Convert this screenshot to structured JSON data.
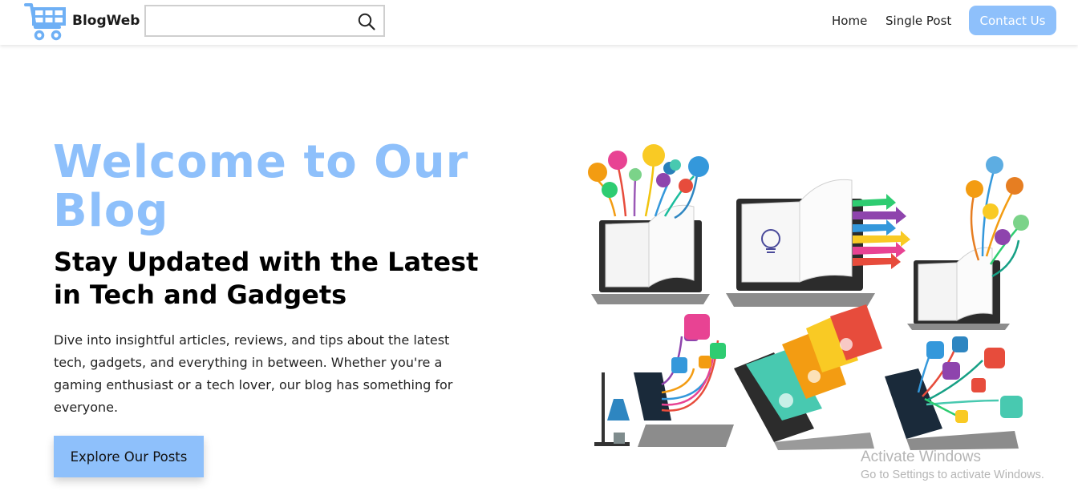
{
  "navbar": {
    "brand": "BlogWeb",
    "search": {
      "value": "",
      "placeholder": ""
    },
    "links": [
      "Home",
      "Single Post"
    ],
    "contact_label": "Contact Us"
  },
  "hero": {
    "title": "Welcome to Our Blog",
    "subtitle": "Stay Updated with the Latest in Tech and Gadgets",
    "description": "Dive into insightful articles, reviews, and tips about the latest tech, gadgets, and everything in between. Whether you're a gaming enthusiast or a tech lover, our blog has something for everyone.",
    "cta_label": "Explore Our Posts"
  },
  "watermark": {
    "line1": "Activate Windows",
    "line2": "Go to Settings to activate Windows."
  },
  "colors": {
    "accent": "#8ec0fb",
    "text": "#111111",
    "background": "#ffffff"
  },
  "icons": [
    "shopping-cart-logo-icon",
    "search-icon"
  ]
}
